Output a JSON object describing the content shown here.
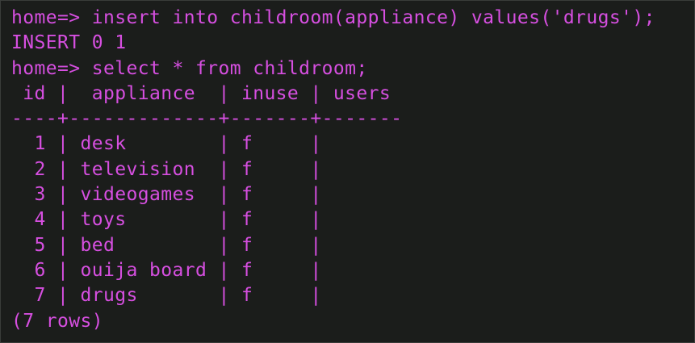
{
  "terminal": {
    "colors": {
      "background": "#1b1d1b",
      "text": "#d64fe0"
    },
    "lines": [
      "home=> insert into childroom(appliance) values('drugs');",
      "INSERT 0 1",
      "home=> select * from childroom;",
      " id |  appliance  | inuse | users",
      "----+-------------+-------+-------",
      "  1 | desk        | f     |",
      "  2 | television  | f     |",
      "  3 | videogames  | f     |",
      "  4 | toys        | f     |",
      "  5 | bed         | f     |",
      "  6 | ouija board | f     |",
      "  7 | drugs       | f     |",
      "(7 rows)"
    ]
  }
}
